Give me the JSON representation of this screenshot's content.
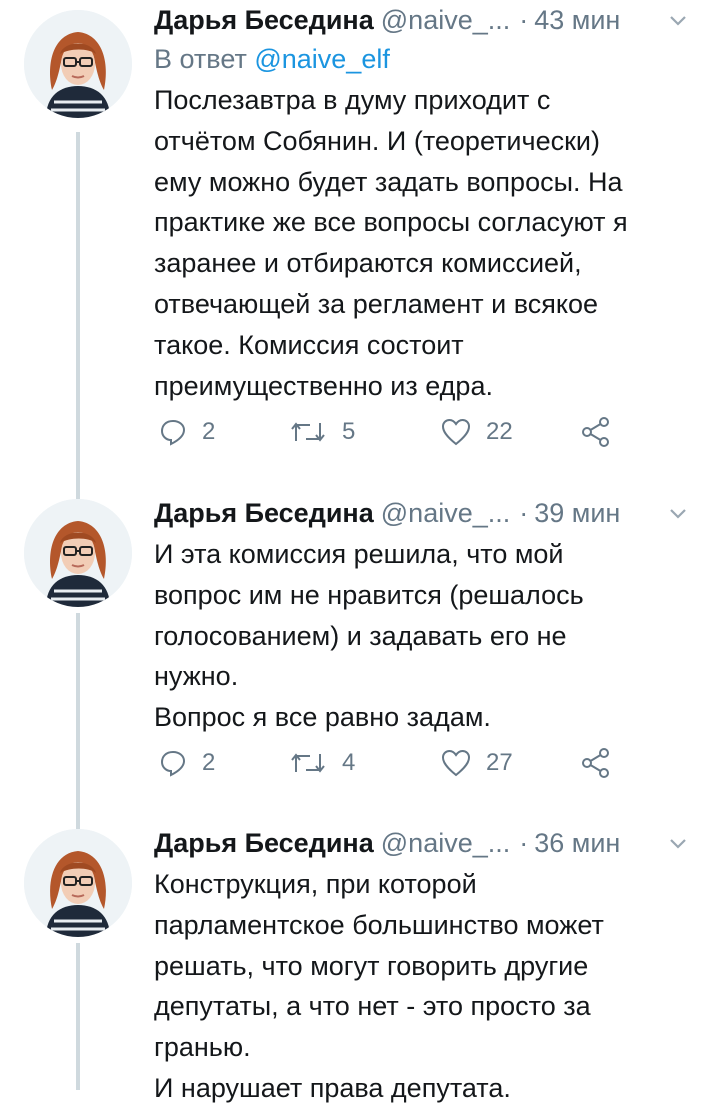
{
  "tweets": [
    {
      "author": "Дарья Беседина",
      "handle": "@naive_...",
      "separator": "·",
      "time": "43 мин",
      "reply_to_prefix": "В ответ",
      "reply_to_mention": "@naive_elf",
      "lines": [
        "Послезавтра в думу приходит с",
        "отчётом Собянин. И (теоретически)",
        "ему можно будет задать вопросы. На",
        "практике же все вопросы согласуют я",
        "заранее и отбираются комиссией,",
        "отвечающей за регламент и всякое",
        "такое. Комиссия состоит",
        "преимущественно из едра."
      ],
      "replies": "2",
      "retweets": "5",
      "likes": "22"
    },
    {
      "author": "Дарья Беседина",
      "handle": "@naive_...",
      "separator": "·",
      "time": "39 мин",
      "lines": [
        "И эта комиссия решила, что мой",
        "вопрос им не нравится (решалось",
        "голосованием) и задавать его не",
        "нужно.",
        "Вопрос я все равно задам."
      ],
      "replies": "2",
      "retweets": "4",
      "likes": "27"
    },
    {
      "author": "Дарья Беседина",
      "handle": "@naive_...",
      "separator": "·",
      "time": "36 мин",
      "lines": [
        "Конструкция, при которой",
        "парламентское большинство может",
        "решать, что могут говорить другие",
        "депутаты, а что нет - это просто за",
        "гранью.",
        "И нарушает права депутата."
      ]
    }
  ],
  "icons": {
    "reply": "reply-icon",
    "retweet": "retweet-icon",
    "like": "heart-icon",
    "share": "share-icon",
    "caret": "chevron-down-icon"
  },
  "colors": {
    "text": "#14171a",
    "secondary": "#657786",
    "link": "#1b95e0",
    "thread_line": "#cfd9de"
  }
}
